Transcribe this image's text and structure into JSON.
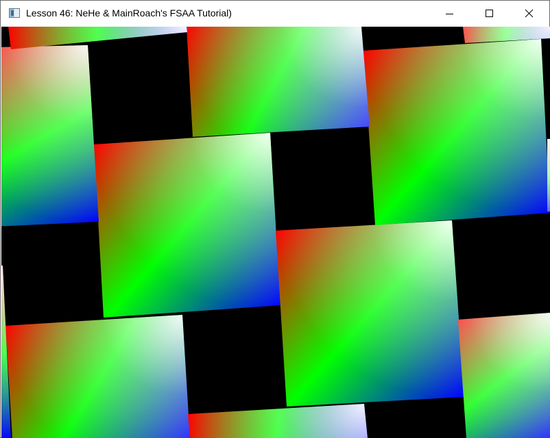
{
  "window": {
    "title": "Lesson 46: NeHe & MainRoach's FSAA Tutorial)",
    "icon": "app-window-icon"
  },
  "controls": {
    "minimize_icon": "minimize-icon",
    "maximize_icon": "maximize-icon",
    "close_icon": "close-icon"
  },
  "scene": {
    "background": "#000000",
    "gradient_colors": {
      "red": "#ff0000",
      "green": "#00ff00",
      "blue": "#0000ff",
      "white": "#ffffff"
    }
  }
}
